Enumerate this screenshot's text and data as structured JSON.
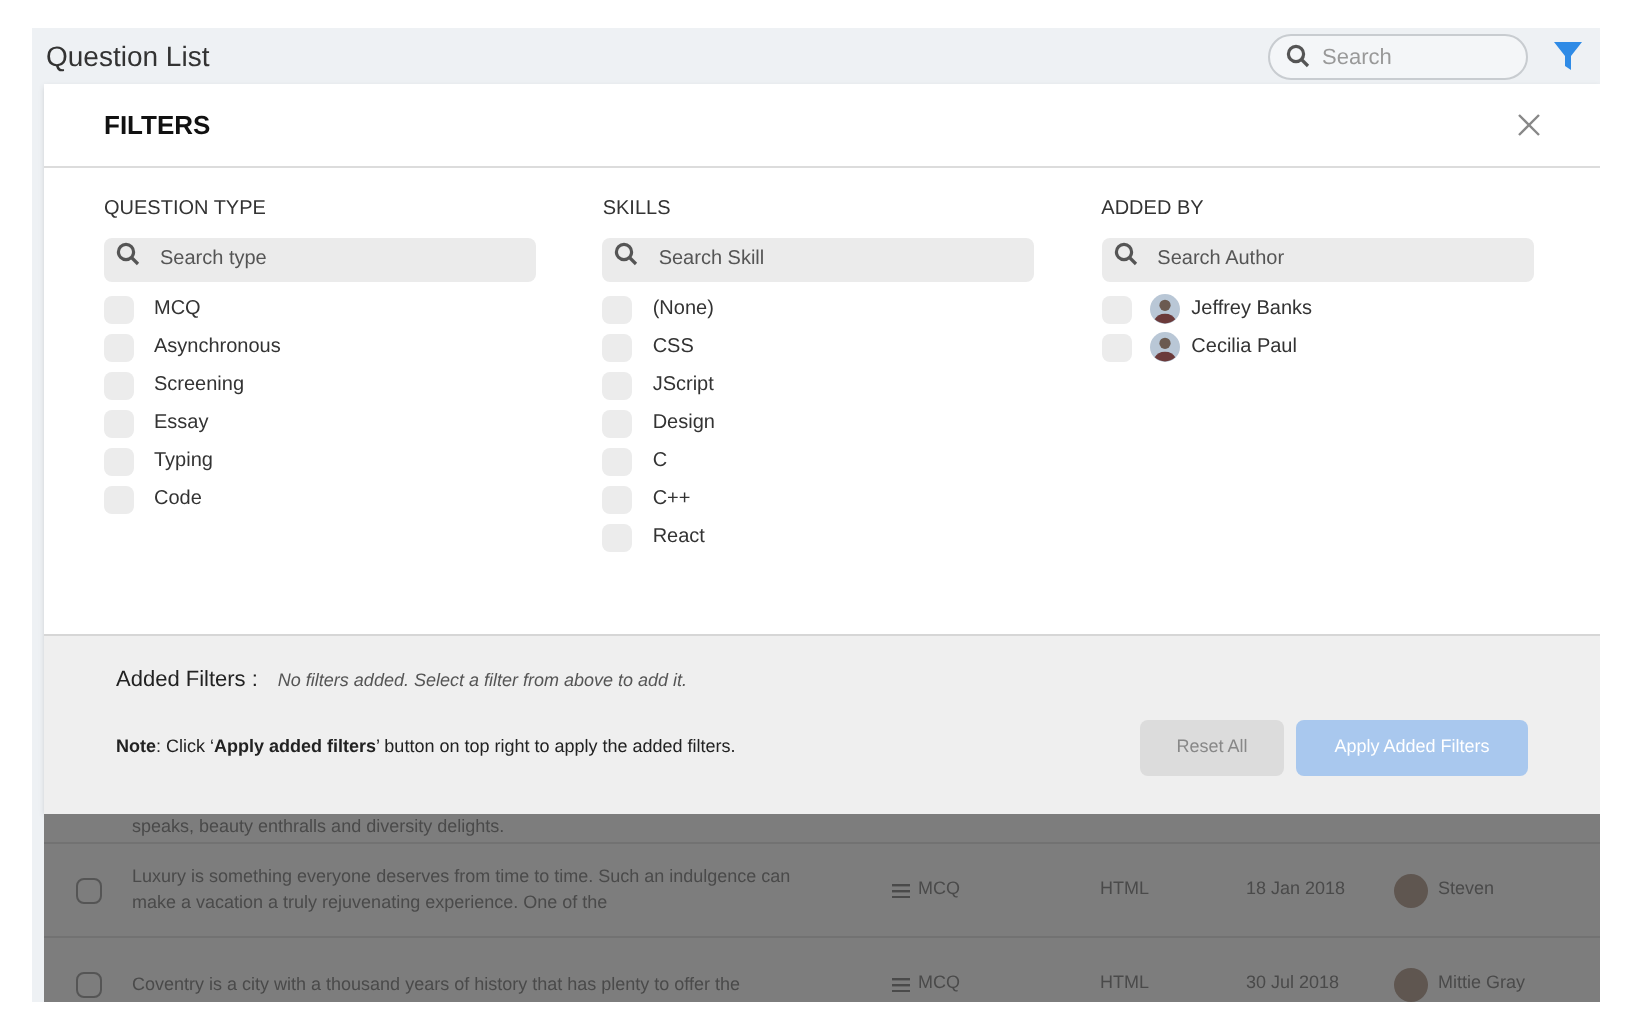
{
  "page_title": "Question List",
  "search": {
    "placeholder": "Search"
  },
  "filters": {
    "title": "FILTERS",
    "groups": [
      {
        "title": "QUESTION TYPE",
        "placeholder": "Search type",
        "options": [
          {
            "label": "MCQ",
            "checked": false
          },
          {
            "label": "Asynchronous",
            "checked": false
          },
          {
            "label": "Screening",
            "checked": false
          },
          {
            "label": "Essay",
            "checked": false
          },
          {
            "label": "Typing",
            "checked": false
          },
          {
            "label": "Code",
            "checked": false
          }
        ]
      },
      {
        "title": "SKILLS",
        "placeholder": "Search Skill",
        "options": [
          {
            "label": "(None)",
            "checked": false
          },
          {
            "label": "CSS",
            "checked": false
          },
          {
            "label": "JScript",
            "checked": false
          },
          {
            "label": "Design",
            "checked": false
          },
          {
            "label": "C",
            "checked": false
          },
          {
            "label": "C++",
            "checked": false
          },
          {
            "label": "React",
            "checked": false
          }
        ]
      },
      {
        "title": "ADDED BY",
        "placeholder": "Search Author",
        "options": [
          {
            "label": "Jeffrey Banks",
            "checked": false,
            "avatar": true
          },
          {
            "label": "Cecilia Paul",
            "checked": false,
            "avatar": true
          }
        ]
      }
    ],
    "added_label": "Added Filters :",
    "added_empty": "No filters added. Select a filter from above to add it.",
    "note": "**Note**: Click ‘**Apply added filters**’ button on top right to apply the added filters.",
    "buttons": [
      {
        "label": "Reset All",
        "kind": "secondary",
        "disabled": true
      },
      {
        "label": "Apply Added Filters",
        "kind": "primary",
        "disabled": true
      }
    ]
  },
  "rows": [
    {
      "text": "speaks, beauty enthralls and diversity delights.",
      "partial": true
    },
    {
      "text": "Luxury is something everyone deserves from time to time. Such an indulgence can make a vacation a truly rejuvenating experience. One of the",
      "type": "MCQ",
      "skill": "HTML",
      "date": "18 Jan 2018",
      "author": "Steven",
      "checked": false
    },
    {
      "text": "Coventry is a city with a thousand years of history that has plenty to offer the",
      "type": "MCQ",
      "skill": "HTML",
      "date": "30 Jul 2018",
      "author": "Mittie Gray",
      "checked": false
    }
  ]
}
